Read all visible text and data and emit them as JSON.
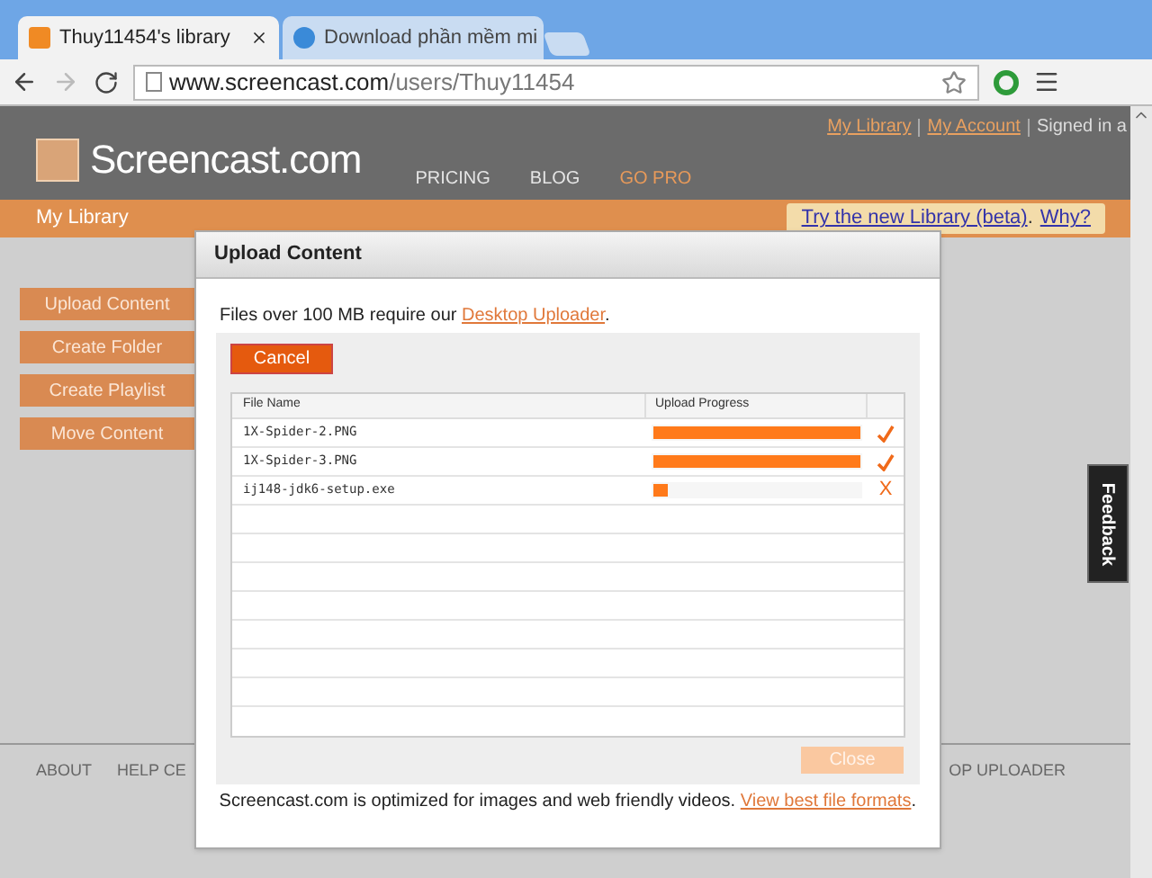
{
  "browser": {
    "tabs": [
      {
        "title": "Thuy11454's library",
        "selected": true
      },
      {
        "title": "Download phần mềm mi",
        "selected": false
      }
    ],
    "address_host": "www.screencast.com",
    "address_path": "/users/Thuy11454"
  },
  "header": {
    "links": [
      "My Library",
      "My Account"
    ],
    "signed_in": "Signed in a",
    "logo": "Screencast.com",
    "nav": [
      {
        "label": "PRICING",
        "kind": "normal"
      },
      {
        "label": "BLOG",
        "kind": "normal"
      },
      {
        "label": "GO PRO",
        "kind": "promo"
      }
    ]
  },
  "subbar": {
    "title": "My Library",
    "try_link": "Try the new Library (beta)",
    "separator": ".",
    "why_link": "Why?"
  },
  "sidebar_buttons": [
    "Upload Content",
    "Create Folder",
    "Create Playlist",
    "Move Content"
  ],
  "footer_links": [
    "ABOUT",
    "HELP CE",
    "OP UPLOADER"
  ],
  "feedback": "Feedback",
  "modal": {
    "title": "Upload Content",
    "note": "Files over 100 MB require our ",
    "note_link": "Desktop Uploader",
    "note_end": ".",
    "cancel": "Cancel",
    "columns": [
      "File Name",
      "Upload Progress"
    ],
    "rows": [
      {
        "name": "1X-Spider-2.PNG",
        "level": 1,
        "kind": "done"
      },
      {
        "name": "1X-Spider-3.PNG",
        "level": 1,
        "kind": "done"
      },
      {
        "name": "ij148-jdk6-setup.exe",
        "level": 0.07,
        "kind": "failed",
        "mark": "X"
      }
    ],
    "close": {
      "label": "Close",
      "disabled": true
    },
    "footer_note": "Screencast.com is optimized for images and web friendly videos. ",
    "footer_link": "View best file formats",
    "footer_end": "."
  }
}
